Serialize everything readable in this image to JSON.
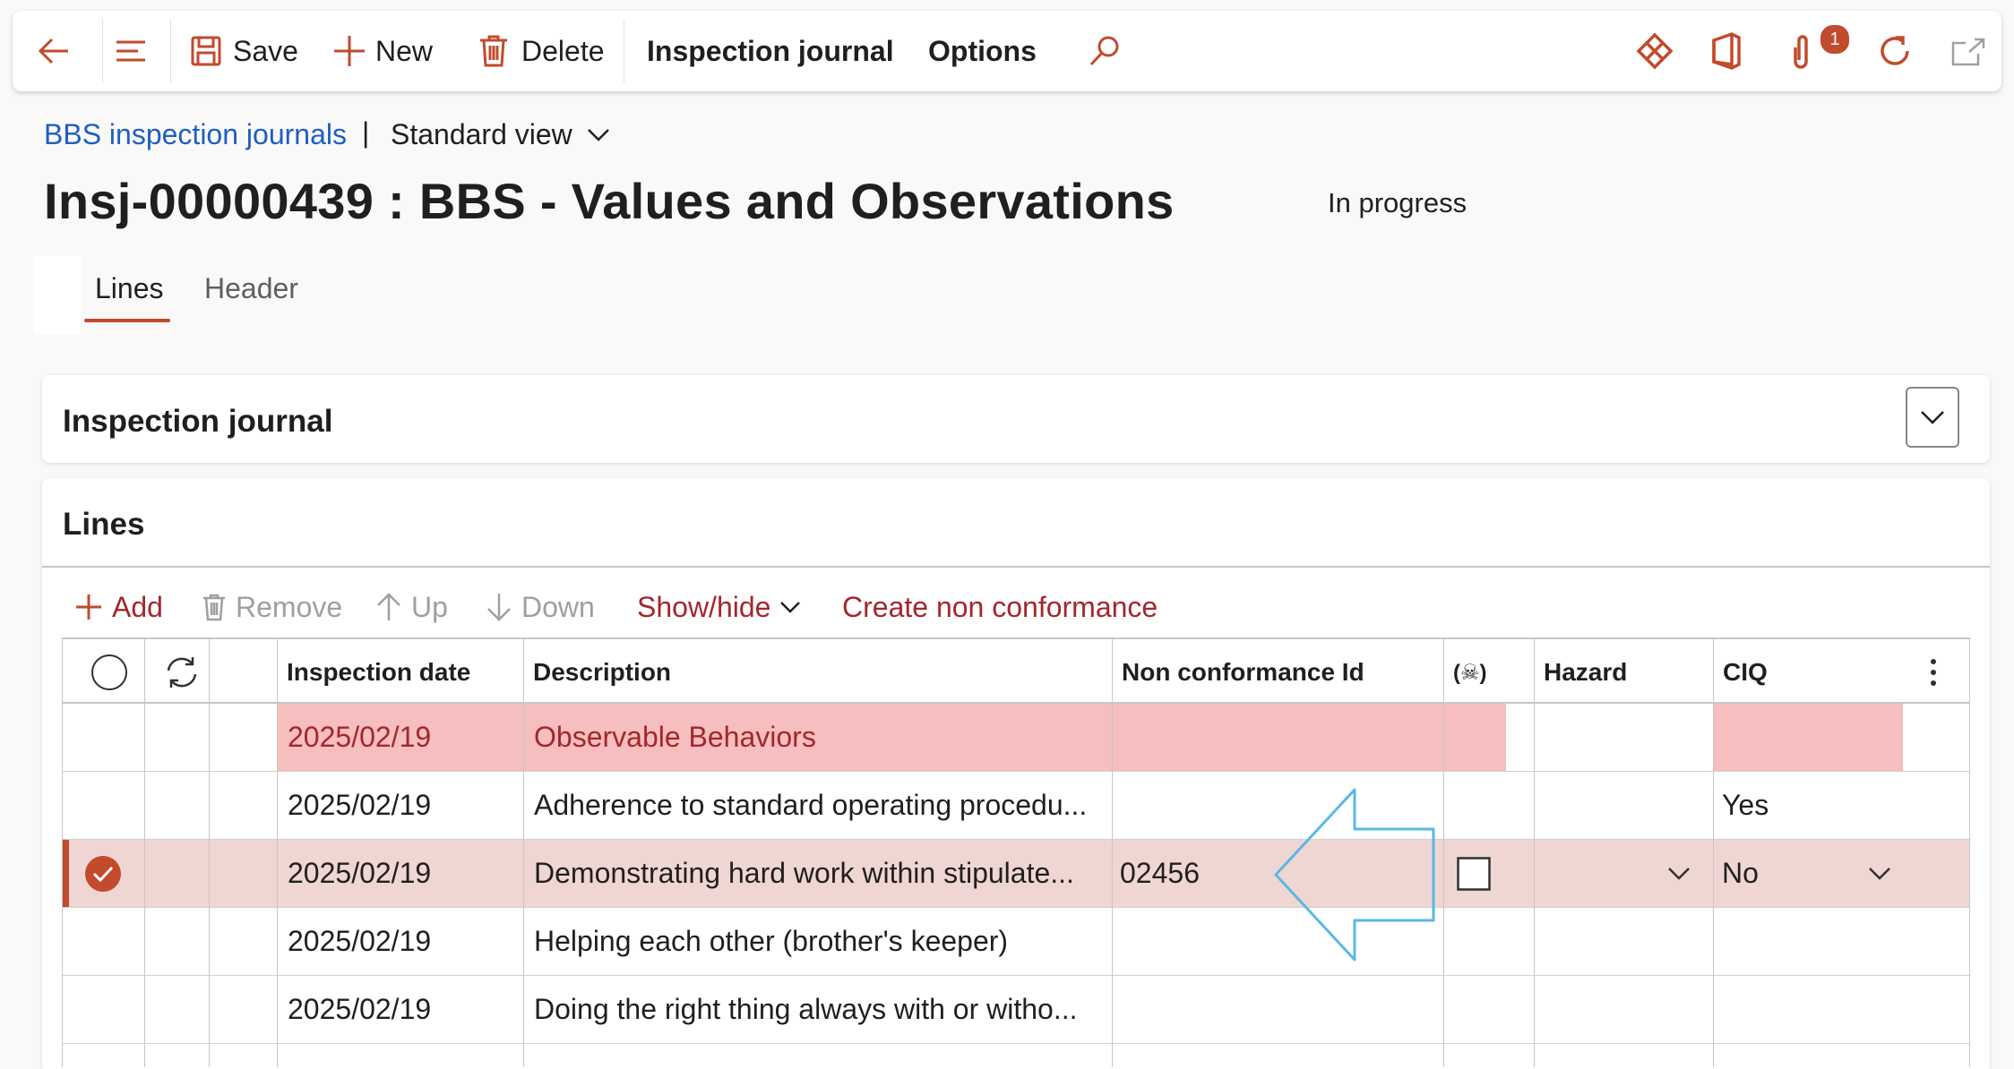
{
  "toolbar": {
    "save": "Save",
    "new": "New",
    "delete": "Delete",
    "inspection_journal": "Inspection journal",
    "options": "Options",
    "notification_count": "1",
    "accent": "#c24a2d"
  },
  "breadcrumb": {
    "link": "BBS inspection journals",
    "separator": "|",
    "view": "Standard view"
  },
  "page": {
    "title": "Insj-00000439 : BBS - Values and Observations",
    "status": "In progress"
  },
  "tabs": [
    {
      "label": "Lines",
      "active": true
    },
    {
      "label": "Header",
      "active": false
    }
  ],
  "journal_panel": {
    "title": "Inspection journal"
  },
  "lines_panel": {
    "title": "Lines",
    "actions": {
      "add": "Add",
      "remove": "Remove",
      "up": "Up",
      "down": "Down",
      "show_hide": "Show/hide",
      "create_nc": "Create non conformance"
    }
  },
  "grid": {
    "columns": {
      "inspection_date": "Inspection date",
      "description": "Description",
      "nc_id": "Non conformance Id",
      "hazard_icon": "(☠)",
      "hazard": "Hazard",
      "ciq": "CIQ"
    },
    "rows": [
      {
        "date": "2025/02/19",
        "description": "Observable Behaviors",
        "nc_id": "",
        "hazard": "",
        "ciq": "",
        "highlight": "pink"
      },
      {
        "date": "2025/02/19",
        "description": "Adherence to standard operating procedu...",
        "nc_id": "",
        "hazard": "",
        "ciq": "Yes",
        "highlight": "none"
      },
      {
        "date": "2025/02/19",
        "description": "Demonstrating hard work within stipulate...",
        "nc_id": "02456",
        "hazard": "",
        "ciq": "No",
        "highlight": "selected"
      },
      {
        "date": "2025/02/19",
        "description": "Helping each other (brother's keeper)",
        "nc_id": "",
        "hazard": "",
        "ciq": "",
        "highlight": "none"
      },
      {
        "date": "2025/02/19",
        "description": "Doing the right thing always with or witho...",
        "nc_id": "",
        "hazard": "",
        "ciq": "",
        "highlight": "none"
      }
    ]
  }
}
